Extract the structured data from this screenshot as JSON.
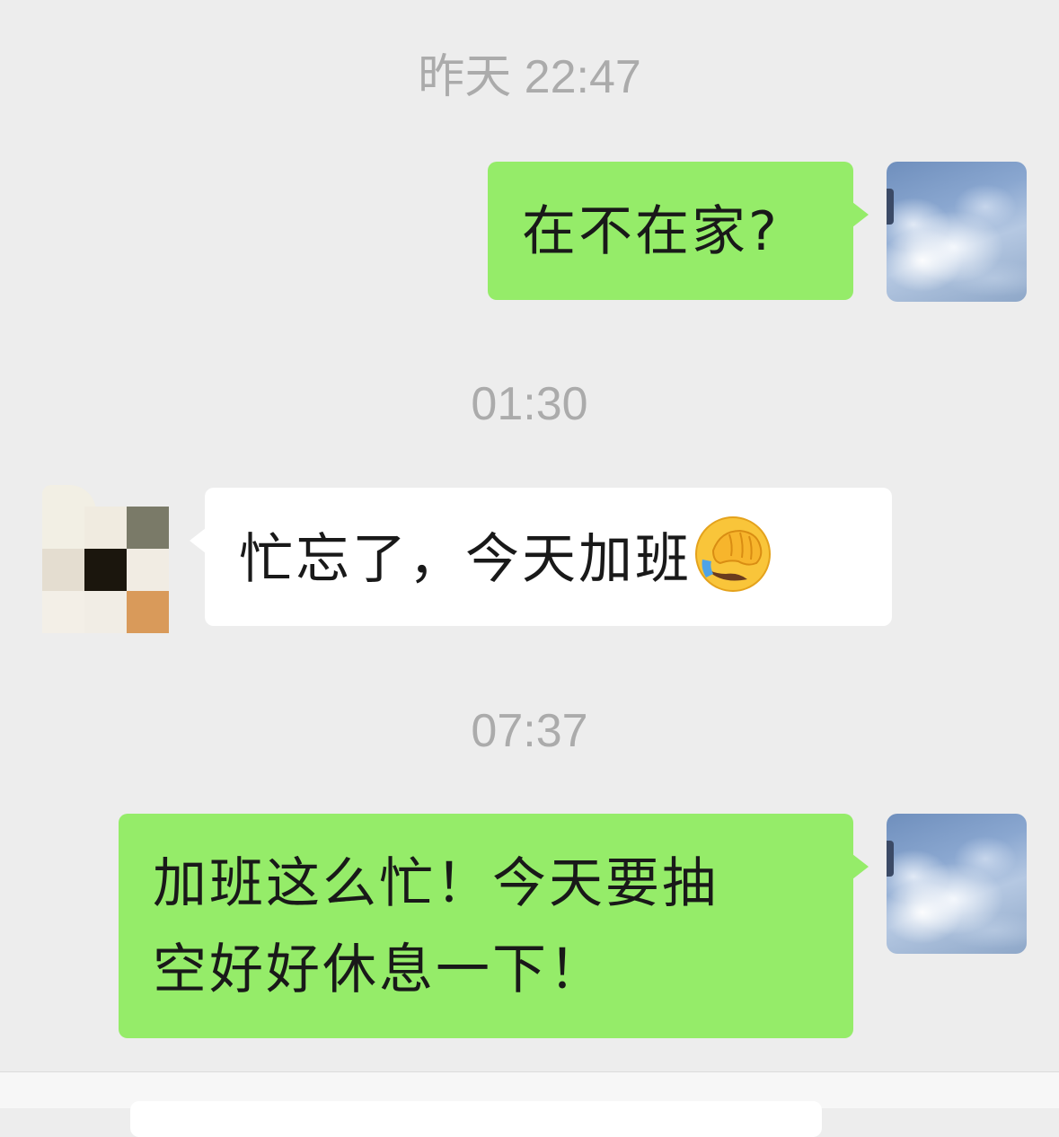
{
  "chat": {
    "timestamps": [
      "昨天 22:47",
      "01:30",
      "07:37"
    ],
    "messages": [
      {
        "side": "sent",
        "text": "在不在家?"
      },
      {
        "side": "received",
        "text": "忙忘了，今天加班",
        "emoji": "face-palm-emoji"
      },
      {
        "side": "sent",
        "line1": "加班这么忙！今天要抽",
        "line2": "空好好休息一下！"
      }
    ]
  },
  "colors": {
    "background": "#ededed",
    "sent_bubble": "#95ec69",
    "received_bubble": "#ffffff",
    "timestamp": "#ababab"
  }
}
